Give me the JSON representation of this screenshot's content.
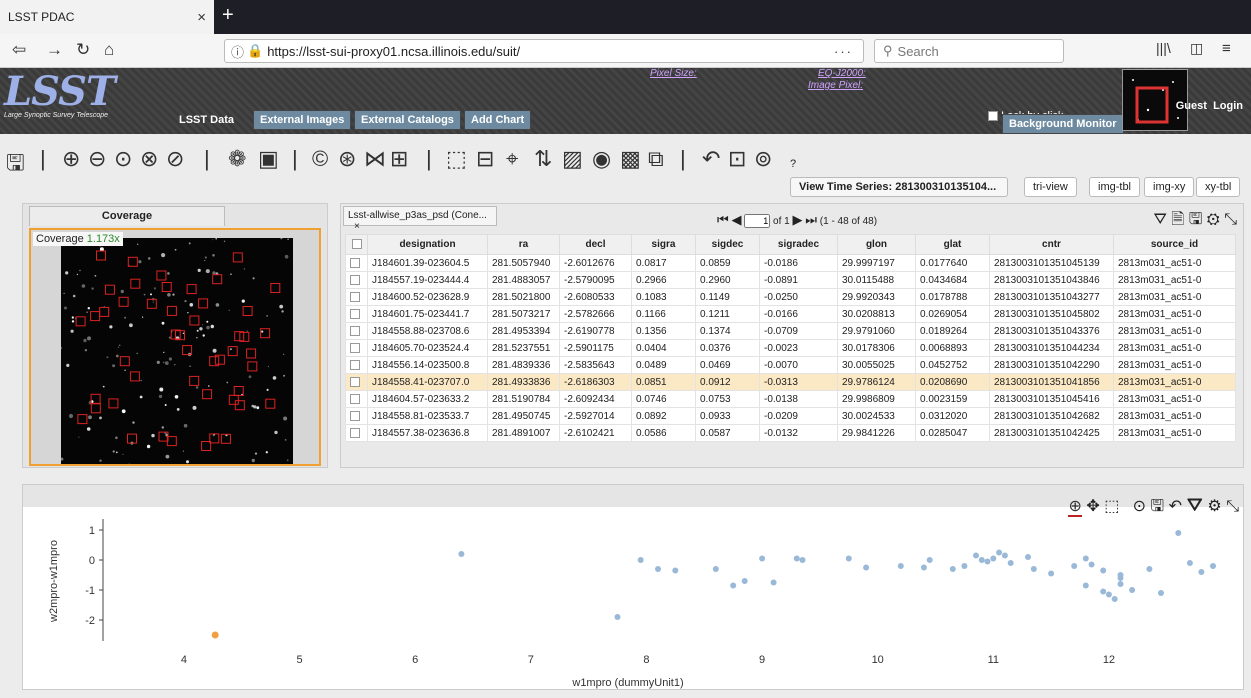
{
  "browser": {
    "tab_title": "LSST PDAC",
    "tab_close": "×",
    "new_tab": "+",
    "url": "https://lsst-sui-proxy01.ncsa.illinois.edu/suit/",
    "url_menu": "···",
    "search_placeholder": "Search"
  },
  "header": {
    "logo_text": "LSST",
    "logo_subtitle": "Large Synoptic Survey Telescope",
    "tabs": [
      "LSST Data",
      "External Images",
      "External Catalogs",
      "Add Chart"
    ],
    "pixel_size_label": "Pixel Size:",
    "eq_label": "EQ-J2000:",
    "image_pixel_label": "Image Pixel:",
    "lock_label": "Lock by click",
    "background_monitor": "Background Monitor",
    "guest": "Guest",
    "login": "Login"
  },
  "toolbar": {
    "view_time_series": "View Time Series: 281300310135104...",
    "view_buttons": [
      "tri-view",
      "img-tbl",
      "img-xy",
      "xy-tbl"
    ],
    "help": "?"
  },
  "coverage": {
    "tab_label": "Coverage",
    "label": "Coverage",
    "zoom": "1.173x"
  },
  "table": {
    "tab_label": "Lsst-allwise_p3as_psd (Cone...",
    "tab_close": "×",
    "page_value": "1",
    "page_of": "of 1",
    "range": "(1 - 48 of 48)",
    "columns": [
      "designation",
      "ra",
      "decl",
      "sigra",
      "sigdec",
      "sigradec",
      "glon",
      "glat",
      "cntr",
      "source_id"
    ],
    "rows": [
      [
        "J184601.39-023604.5",
        "281.5057940",
        "-2.6012676",
        "0.0817",
        "0.0859",
        "-0.0186",
        "29.9997197",
        "0.0177640",
        "2813003101351045139",
        "2813m031_ac51-0"
      ],
      [
        "J184557.19-023444.4",
        "281.4883057",
        "-2.5790095",
        "0.2966",
        "0.2960",
        "-0.0891",
        "30.0115488",
        "0.0434684",
        "2813003101351043846",
        "2813m031_ac51-0"
      ],
      [
        "J184600.52-023628.9",
        "281.5021800",
        "-2.6080533",
        "0.1083",
        "0.1149",
        "-0.0250",
        "29.9920343",
        "0.0178788",
        "2813003101351043277",
        "2813m031_ac51-0"
      ],
      [
        "J184601.75-023441.7",
        "281.5073217",
        "-2.5782666",
        "0.1166",
        "0.1211",
        "-0.0166",
        "30.0208813",
        "0.0269054",
        "2813003101351045802",
        "2813m031_ac51-0"
      ],
      [
        "J184558.88-023708.6",
        "281.4953394",
        "-2.6190778",
        "0.1356",
        "0.1374",
        "-0.0709",
        "29.9791060",
        "0.0189264",
        "2813003101351043376",
        "2813m031_ac51-0"
      ],
      [
        "J184605.70-023524.4",
        "281.5237551",
        "-2.5901175",
        "0.0404",
        "0.0376",
        "-0.0023",
        "30.0178306",
        "0.0068893",
        "2813003101351044234",
        "2813m031_ac51-0"
      ],
      [
        "J184556.14-023500.8",
        "281.4839336",
        "-2.5835643",
        "0.0489",
        "0.0469",
        "-0.0070",
        "30.0055025",
        "0.0452752",
        "2813003101351042290",
        "2813m031_ac51-0"
      ],
      [
        "J184558.41-023707.0",
        "281.4933836",
        "-2.6186303",
        "0.0851",
        "0.0912",
        "-0.0313",
        "29.9786124",
        "0.0208690",
        "2813003101351041856",
        "2813m031_ac51-0"
      ],
      [
        "J184604.57-023633.2",
        "281.5190784",
        "-2.6092434",
        "0.0746",
        "0.0753",
        "-0.0138",
        "29.9986809",
        "0.0023159",
        "2813003101351045416",
        "2813m031_ac51-0"
      ],
      [
        "J184558.81-023533.7",
        "281.4950745",
        "-2.5927014",
        "0.0892",
        "0.0933",
        "-0.0209",
        "30.0024533",
        "0.0312020",
        "2813003101351042682",
        "2813m031_ac51-0"
      ],
      [
        "J184557.38-023636.8",
        "281.4891007",
        "-2.6102421",
        "0.0586",
        "0.0587",
        "-0.0132",
        "29.9841226",
        "0.0285047",
        "2813003101351042425",
        "2813m031_ac51-0"
      ]
    ],
    "selected_row": 7
  },
  "chart_data": {
    "type": "scatter",
    "xlabel": "w1mpro (dummyUnit1)",
    "ylabel": "w2mpro-w1mpro",
    "xlim": [
      3.3,
      12.9
    ],
    "ylim": [
      -2.7,
      1.3
    ],
    "xticks": [
      4,
      5,
      6,
      7,
      8,
      9,
      10,
      11,
      12
    ],
    "yticks": [
      1,
      0,
      -1,
      -2
    ],
    "point_color": "#9ab8d8",
    "highlight_color": "#f0a040",
    "points": [
      [
        6.4,
        0.2
      ],
      [
        7.75,
        -1.9
      ],
      [
        7.95,
        0.0
      ],
      [
        8.1,
        -0.3
      ],
      [
        8.25,
        -0.35
      ],
      [
        8.6,
        -0.3
      ],
      [
        8.75,
        -0.85
      ],
      [
        8.85,
        -0.7
      ],
      [
        9.0,
        0.05
      ],
      [
        9.1,
        -0.75
      ],
      [
        9.3,
        0.05
      ],
      [
        9.35,
        0.0
      ],
      [
        9.75,
        0.05
      ],
      [
        9.9,
        -0.25
      ],
      [
        10.2,
        -0.2
      ],
      [
        10.4,
        -0.25
      ],
      [
        10.45,
        0.0
      ],
      [
        10.65,
        -0.3
      ],
      [
        10.75,
        -0.2
      ],
      [
        10.85,
        0.15
      ],
      [
        10.9,
        0.0
      ],
      [
        10.95,
        -0.05
      ],
      [
        11.0,
        0.05
      ],
      [
        11.05,
        0.25
      ],
      [
        11.1,
        0.15
      ],
      [
        11.15,
        -0.1
      ],
      [
        11.3,
        0.1
      ],
      [
        11.35,
        -0.3
      ],
      [
        11.5,
        -0.45
      ],
      [
        11.7,
        -0.2
      ],
      [
        11.8,
        0.05
      ],
      [
        11.95,
        -0.35
      ],
      [
        12.1,
        -0.6
      ],
      [
        11.85,
        -0.15
      ],
      [
        11.8,
        -0.85
      ],
      [
        11.95,
        -1.05
      ],
      [
        12.05,
        -1.3
      ],
      [
        12.0,
        -1.15
      ],
      [
        12.1,
        -0.5
      ],
      [
        12.1,
        -0.8
      ],
      [
        12.2,
        -1.0
      ],
      [
        12.35,
        -0.3
      ],
      [
        12.45,
        -1.1
      ],
      [
        12.6,
        0.9
      ],
      [
        12.7,
        -0.1
      ],
      [
        12.8,
        -0.4
      ],
      [
        12.9,
        -0.2
      ]
    ],
    "highlight_points": [
      [
        4.27,
        -2.5
      ]
    ]
  }
}
